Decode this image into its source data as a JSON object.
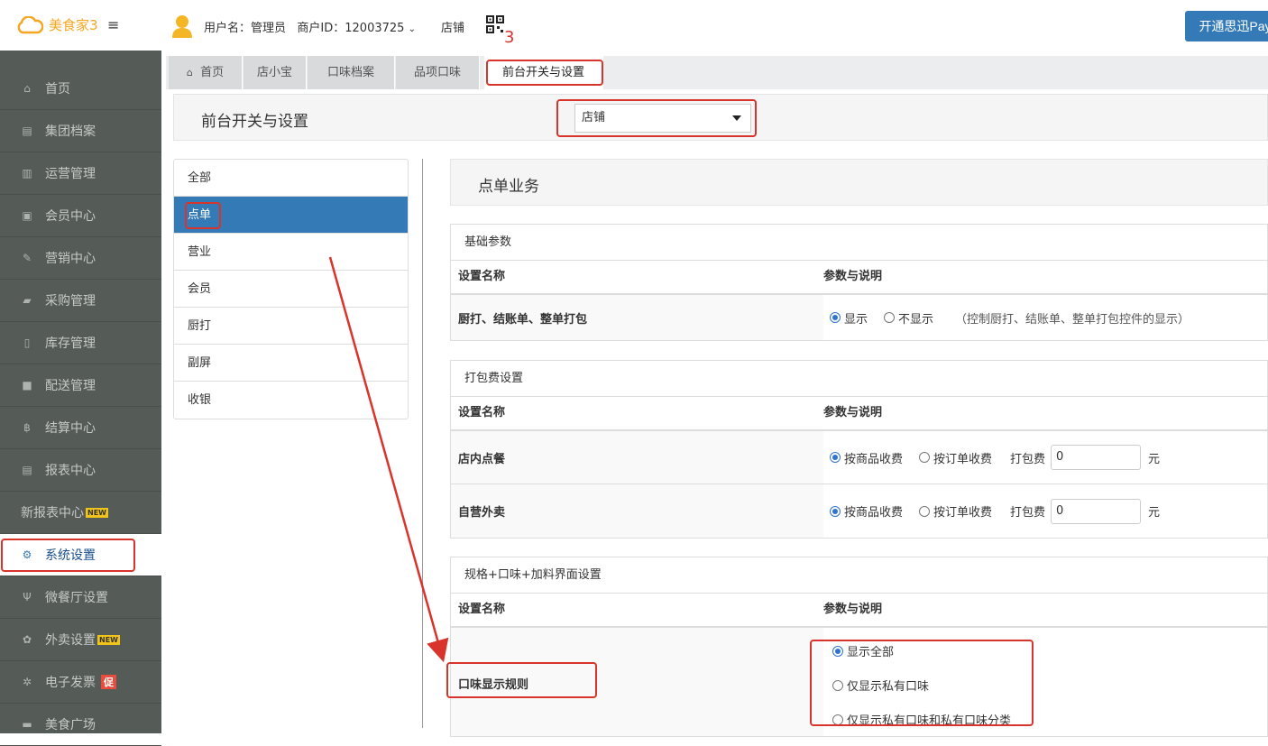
{
  "brand": {
    "name": "美食家3"
  },
  "header": {
    "user_label": "用户名：管理员",
    "merchant_label": "商户ID：12003725",
    "store_link": "店铺",
    "qr_annotation": "3",
    "pay_button": "开通思迅Pay"
  },
  "sidebar": {
    "items": [
      {
        "label": "首页",
        "icon": "home-icon"
      },
      {
        "label": "集团档案",
        "icon": "file-icon"
      },
      {
        "label": "运营管理",
        "icon": "bar-chart-icon"
      },
      {
        "label": "会员中心",
        "icon": "id-card-icon"
      },
      {
        "label": "营销中心",
        "icon": "edit-icon"
      },
      {
        "label": "采购管理",
        "icon": "book-icon"
      },
      {
        "label": "库存管理",
        "icon": "building-icon"
      },
      {
        "label": "配送管理",
        "icon": "truck-icon"
      },
      {
        "label": "结算中心",
        "icon": "bitcoin-icon"
      },
      {
        "label": "报表中心",
        "icon": "document-icon"
      },
      {
        "label": "新报表中心",
        "icon": "",
        "badge": "NEW"
      },
      {
        "label": "系统设置",
        "icon": "gears-icon"
      },
      {
        "label": "微餐厅设置",
        "icon": "cutlery-icon"
      },
      {
        "label": "外卖设置",
        "icon": "gear-icon",
        "badge": "NEW"
      },
      {
        "label": "电子发票",
        "icon": "asterisk-icon",
        "badge": "促"
      },
      {
        "label": "美食广场",
        "icon": "coffee-icon"
      }
    ],
    "active_index": 11
  },
  "tabs": [
    {
      "label": "首页"
    },
    {
      "label": "店小宝"
    },
    {
      "label": "口味档案"
    },
    {
      "label": "品项口味"
    },
    {
      "label": "前台开关与设置"
    }
  ],
  "page": {
    "title": "前台开关与设置",
    "scope_select": "店铺"
  },
  "categories": [
    "全部",
    "点单",
    "营业",
    "会员",
    "厨打",
    "副屏",
    "收银"
  ],
  "active_category": "点单",
  "section_title": "点单业务",
  "table_headers": {
    "name": "设置名称",
    "param": "参数与说明"
  },
  "panels": {
    "basic": {
      "title": "基础参数",
      "row_label": "厨打、结账单、整单打包",
      "opt_show": "显示",
      "opt_hide": "不显示",
      "note": "（控制厨打、结账单、整单打包控件的显示）"
    },
    "packing": {
      "title": "打包费设置",
      "rows": [
        {
          "label": "店内点餐",
          "opt_item": "按商品收费",
          "opt_order": "按订单收费",
          "fee_label": "打包费",
          "fee": "0",
          "unit": "元"
        },
        {
          "label": "自营外卖",
          "opt_item": "按商品收费",
          "opt_order": "按订单收费",
          "fee_label": "打包费",
          "fee": "0",
          "unit": "元"
        }
      ]
    },
    "spec": {
      "title": "规格+口味+加料界面设置",
      "row_label": "口味显示规则",
      "options": [
        "显示全部",
        "仅显示私有口味",
        "仅显示私有口味和私有口味分类"
      ]
    }
  },
  "colors": {
    "accent": "#337ab7",
    "annotation": "#d9342b",
    "sidebar": "#555b57",
    "brand": "#f5a623"
  }
}
